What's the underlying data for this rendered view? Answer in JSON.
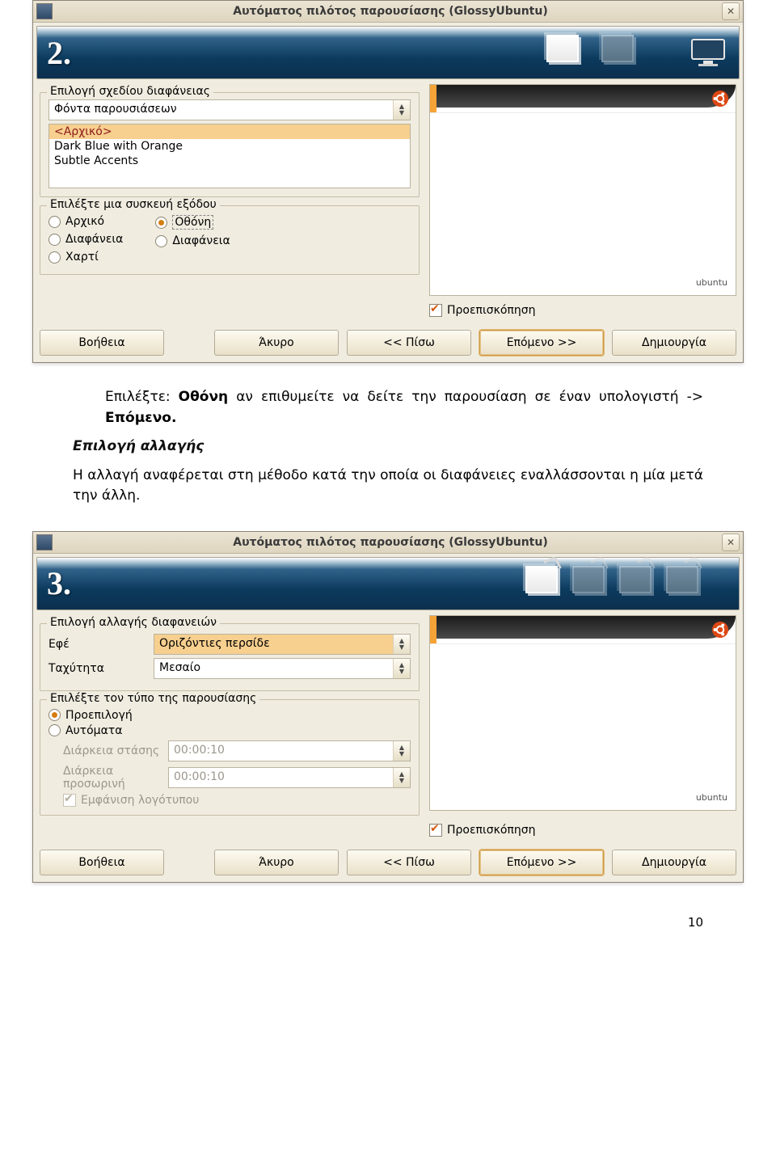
{
  "win1": {
    "title": "Αυτόματος πιλότος παρουσίασης (GlossyUbuntu)",
    "step": "2.",
    "group_design": {
      "legend": "Επιλογή σχεδίου διαφάνειας",
      "combo": "Φόντα παρουσιάσεων",
      "items": [
        "<Αρχικό>",
        "Dark Blue with Orange",
        "Subtle Accents"
      ]
    },
    "group_output": {
      "legend": "Επιλέξτε μια συσκευή εξόδου",
      "left": [
        "Αρχικό",
        "Διαφάνεια",
        "Χαρτί"
      ],
      "right": [
        "Οθόνη",
        "Διαφάνεια"
      ]
    },
    "preview_footer": "ubuntu",
    "preview_chk": "Προεπισκόπηση",
    "buttons": {
      "help": "Βοήθεια",
      "cancel": "Άκυρο",
      "back": "<< Πίσω",
      "next": "Επόμενο >>",
      "create": "Δημιουργία"
    }
  },
  "mid": {
    "para1a": "Επιλέξτε: ",
    "para1b": "Οθόνη",
    "para1c": " αν επιθυμείτε να δείτε την παρουσίαση σε έναν υπολογιστή -> ",
    "para1d": "Επόμενο.",
    "heading": "Επιλογή αλλαγής",
    "para2": "Η αλλαγή αναφέρεται στη μέθοδο κατά την οποία οι διαφάνειες εναλλάσσονται η μία μετά την άλλη."
  },
  "win2": {
    "title": "Αυτόματος πιλότος παρουσίασης (GlossyUbuntu)",
    "step": "3.",
    "group_transition": {
      "legend": "Επιλογή αλλαγής διαφανειών",
      "row1_label": "Εφέ",
      "row1_value": "Οριζόντιες περσίδε",
      "row2_label": "Ταχύτητα",
      "row2_value": "Μεσαίο"
    },
    "group_type": {
      "legend": "Επιλέξτε τον τύπο της παρουσίασης",
      "opt1": "Προεπιλογή",
      "opt2": "Αυτόματα",
      "dur1_label": "Διάρκεια στάσης",
      "dur1_value": "00:00:10",
      "dur2_label": "Διάρκεια προσωρινή",
      "dur2_value": "00:00:10",
      "show_logo": "Εμφάνιση λογότυπου"
    },
    "preview_footer": "ubuntu",
    "preview_chk": "Προεπισκόπηση",
    "buttons": {
      "help": "Βοήθεια",
      "cancel": "Άκυρο",
      "back": "<< Πίσω",
      "next": "Επόμενο >>",
      "create": "Δημιουργία"
    }
  },
  "page_number": "10"
}
